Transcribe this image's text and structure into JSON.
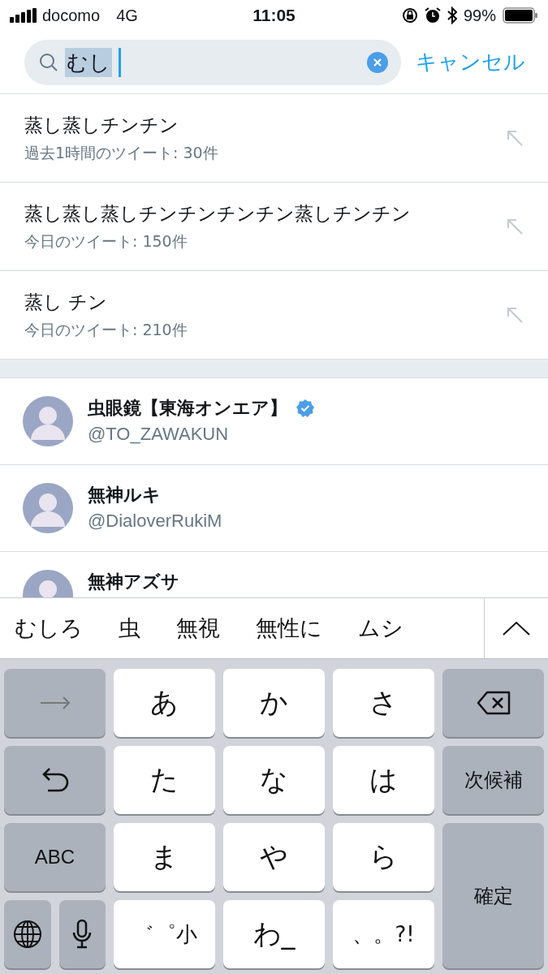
{
  "status_bar": {
    "carrier": "docomo",
    "network": "4G",
    "time": "11:05",
    "battery": "99%"
  },
  "search": {
    "value": "むし",
    "cancel": "キャンセル"
  },
  "suggestions": [
    {
      "text": "蒸し蒸しチンチン",
      "count": "過去1時間のツイート: 30件"
    },
    {
      "text": "蒸し蒸し蒸しチンチンチンチン蒸しチンチン",
      "count": "今日のツイート: 150件"
    },
    {
      "text": "蒸し チン",
      "count": "今日のツイート: 210件"
    }
  ],
  "users": [
    {
      "name": "虫眼鏡【東海オンエア】",
      "handle": "@TO_ZAWAKUN",
      "verified": true
    },
    {
      "name": "無神ルキ",
      "handle": "@DialoverRukiM",
      "verified": false
    },
    {
      "name": "無神アズサ",
      "verified": false
    }
  ],
  "candidates": [
    "むしろ",
    "虫",
    "無視",
    "無性に",
    "ムシ"
  ],
  "keyboard": {
    "keys": [
      {
        "kind": "arrow"
      },
      {
        "kind": "letter",
        "label": "あ"
      },
      {
        "kind": "letter",
        "label": "か"
      },
      {
        "kind": "letter",
        "label": "さ"
      },
      {
        "kind": "backspace"
      },
      {
        "kind": "undo"
      },
      {
        "kind": "letter",
        "label": "た"
      },
      {
        "kind": "letter",
        "label": "な"
      },
      {
        "kind": "letter",
        "label": "は"
      },
      {
        "kind": "function",
        "label": "次候補"
      },
      {
        "kind": "function",
        "label": "ABC"
      },
      {
        "kind": "letter",
        "label": "ま"
      },
      {
        "kind": "letter",
        "label": "や"
      },
      {
        "kind": "letter",
        "label": "ら"
      },
      {
        "kind": "confirm",
        "label": "確定"
      },
      {
        "kind": "globe"
      },
      {
        "kind": "mic"
      },
      {
        "kind": "letter",
        "label": "゛゜小"
      },
      {
        "kind": "letter",
        "label": "わ_"
      },
      {
        "kind": "letter",
        "label": "、。?!"
      }
    ]
  }
}
